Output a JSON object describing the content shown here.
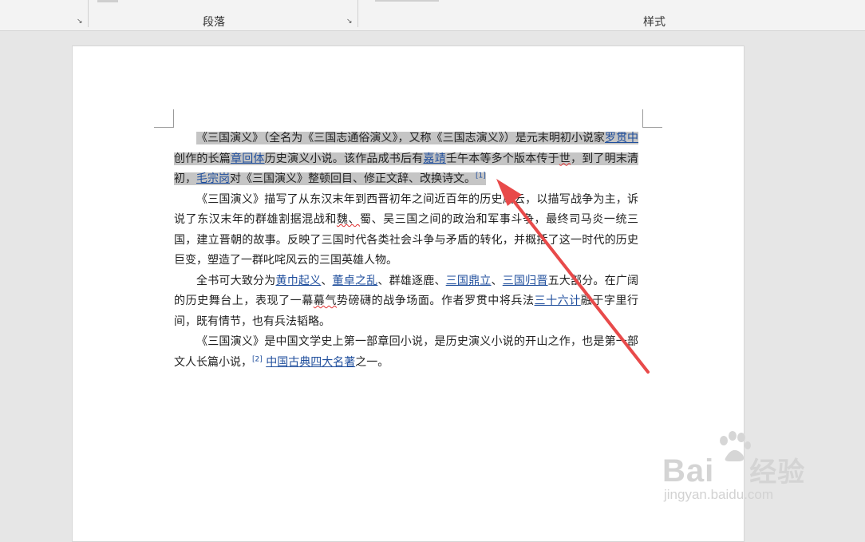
{
  "ribbon": {
    "paragraph_label": "段落",
    "styles_label": "样式",
    "launcher_glyph": "↘"
  },
  "document": {
    "p1": {
      "s1": "《三国演义》（全名为《三国志通俗演义》，又称《三国志演义》）是元末明初小说家",
      "l1": "罗贯中",
      "s2": "创作的长篇",
      "l2": "章回体",
      "s3": "历史演义小说。该作品成书后有",
      "l3": "嘉靖",
      "s4": "壬午本等多个版本传于",
      "s4w": "世",
      "s5": "，到了明末清初，",
      "l4": "毛宗岗",
      "s6": "对《三国演义》整顿回目、修正文辞、改换诗文。",
      "ref": "[1]"
    },
    "p2": {
      "s1": "《三国演义》描写了从东汉末年到西晋初年之间近百年的历史风云，以描写战争为主，诉说了东汉末年的群雄割据混战和",
      "s1w": "魏、",
      "s2": "蜀、吴三国之间的政治和军事斗争，最终司马炎一统三国，建立晋朝的故事。反映了三国时代各类社会斗争与矛盾的转化，并概括了这一时代的历史巨变，塑造了一群叱咤风云的三国英雄人物。"
    },
    "p3": {
      "s1": "全书可大致分为",
      "l1": "黄巾起义",
      "s2": "、",
      "l2": "董卓之乱",
      "s3": "、群雄逐鹿、",
      "l3": "三国鼎立",
      "s4": "、",
      "l4": "三国归晋",
      "s5": "五大部分。在广阔的历史舞台上，表现了一幕",
      "s5w": "幕气",
      "s6": "势磅礴的战争场面。作者罗贯中将兵法",
      "l5": "三十六计",
      "s7": "融于字里行间，既有情节，也有兵法韬略。"
    },
    "p4": {
      "s1": "《三国演义》是中国文学史上第一部章回小说，是历史演义小说的开山之作，也是第一部文人长篇小说，",
      "ref": "[2]",
      "l1": "中国古典四大名著",
      "s2": "之一。"
    }
  },
  "watermark": {
    "brand": "Bai",
    "brand_tail": "经验",
    "url": "jingyan.baidu.com"
  },
  "colors": {
    "link": "#1f4e9c",
    "selection": "#c5c5c5",
    "arrow": "#e84a4a"
  }
}
